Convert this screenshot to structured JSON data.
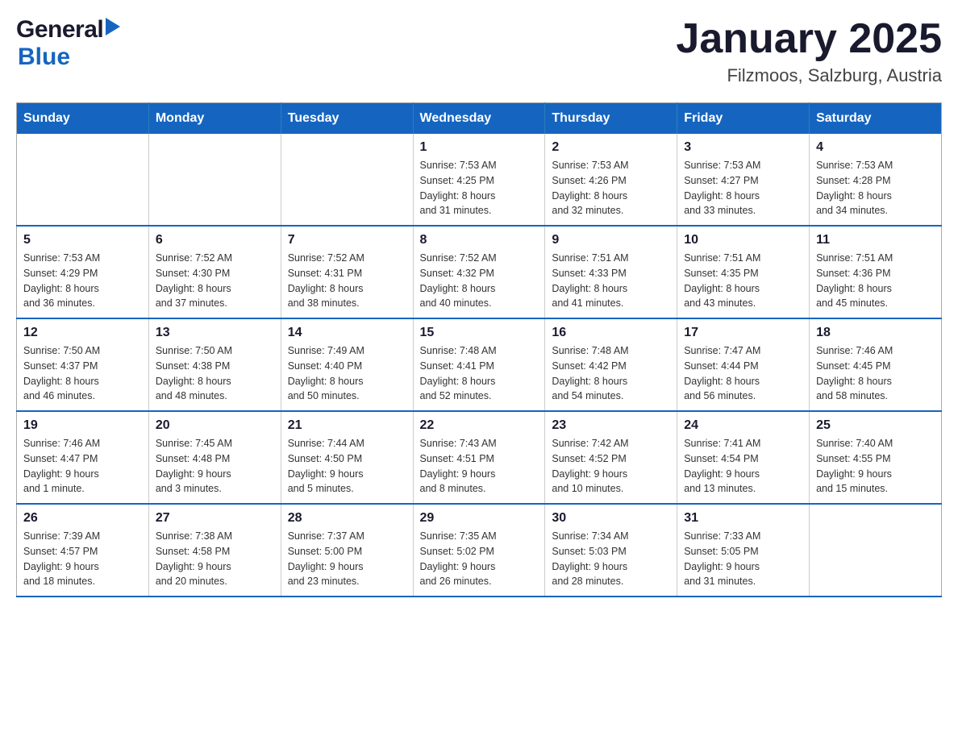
{
  "header": {
    "logo_general": "General",
    "logo_blue": "Blue",
    "title": "January 2025",
    "subtitle": "Filzmoos, Salzburg, Austria"
  },
  "days_of_week": [
    "Sunday",
    "Monday",
    "Tuesday",
    "Wednesday",
    "Thursday",
    "Friday",
    "Saturday"
  ],
  "weeks": [
    [
      {
        "day": "",
        "info": ""
      },
      {
        "day": "",
        "info": ""
      },
      {
        "day": "",
        "info": ""
      },
      {
        "day": "1",
        "info": "Sunrise: 7:53 AM\nSunset: 4:25 PM\nDaylight: 8 hours\nand 31 minutes."
      },
      {
        "day": "2",
        "info": "Sunrise: 7:53 AM\nSunset: 4:26 PM\nDaylight: 8 hours\nand 32 minutes."
      },
      {
        "day": "3",
        "info": "Sunrise: 7:53 AM\nSunset: 4:27 PM\nDaylight: 8 hours\nand 33 minutes."
      },
      {
        "day": "4",
        "info": "Sunrise: 7:53 AM\nSunset: 4:28 PM\nDaylight: 8 hours\nand 34 minutes."
      }
    ],
    [
      {
        "day": "5",
        "info": "Sunrise: 7:53 AM\nSunset: 4:29 PM\nDaylight: 8 hours\nand 36 minutes."
      },
      {
        "day": "6",
        "info": "Sunrise: 7:52 AM\nSunset: 4:30 PM\nDaylight: 8 hours\nand 37 minutes."
      },
      {
        "day": "7",
        "info": "Sunrise: 7:52 AM\nSunset: 4:31 PM\nDaylight: 8 hours\nand 38 minutes."
      },
      {
        "day": "8",
        "info": "Sunrise: 7:52 AM\nSunset: 4:32 PM\nDaylight: 8 hours\nand 40 minutes."
      },
      {
        "day": "9",
        "info": "Sunrise: 7:51 AM\nSunset: 4:33 PM\nDaylight: 8 hours\nand 41 minutes."
      },
      {
        "day": "10",
        "info": "Sunrise: 7:51 AM\nSunset: 4:35 PM\nDaylight: 8 hours\nand 43 minutes."
      },
      {
        "day": "11",
        "info": "Sunrise: 7:51 AM\nSunset: 4:36 PM\nDaylight: 8 hours\nand 45 minutes."
      }
    ],
    [
      {
        "day": "12",
        "info": "Sunrise: 7:50 AM\nSunset: 4:37 PM\nDaylight: 8 hours\nand 46 minutes."
      },
      {
        "day": "13",
        "info": "Sunrise: 7:50 AM\nSunset: 4:38 PM\nDaylight: 8 hours\nand 48 minutes."
      },
      {
        "day": "14",
        "info": "Sunrise: 7:49 AM\nSunset: 4:40 PM\nDaylight: 8 hours\nand 50 minutes."
      },
      {
        "day": "15",
        "info": "Sunrise: 7:48 AM\nSunset: 4:41 PM\nDaylight: 8 hours\nand 52 minutes."
      },
      {
        "day": "16",
        "info": "Sunrise: 7:48 AM\nSunset: 4:42 PM\nDaylight: 8 hours\nand 54 minutes."
      },
      {
        "day": "17",
        "info": "Sunrise: 7:47 AM\nSunset: 4:44 PM\nDaylight: 8 hours\nand 56 minutes."
      },
      {
        "day": "18",
        "info": "Sunrise: 7:46 AM\nSunset: 4:45 PM\nDaylight: 8 hours\nand 58 minutes."
      }
    ],
    [
      {
        "day": "19",
        "info": "Sunrise: 7:46 AM\nSunset: 4:47 PM\nDaylight: 9 hours\nand 1 minute."
      },
      {
        "day": "20",
        "info": "Sunrise: 7:45 AM\nSunset: 4:48 PM\nDaylight: 9 hours\nand 3 minutes."
      },
      {
        "day": "21",
        "info": "Sunrise: 7:44 AM\nSunset: 4:50 PM\nDaylight: 9 hours\nand 5 minutes."
      },
      {
        "day": "22",
        "info": "Sunrise: 7:43 AM\nSunset: 4:51 PM\nDaylight: 9 hours\nand 8 minutes."
      },
      {
        "day": "23",
        "info": "Sunrise: 7:42 AM\nSunset: 4:52 PM\nDaylight: 9 hours\nand 10 minutes."
      },
      {
        "day": "24",
        "info": "Sunrise: 7:41 AM\nSunset: 4:54 PM\nDaylight: 9 hours\nand 13 minutes."
      },
      {
        "day": "25",
        "info": "Sunrise: 7:40 AM\nSunset: 4:55 PM\nDaylight: 9 hours\nand 15 minutes."
      }
    ],
    [
      {
        "day": "26",
        "info": "Sunrise: 7:39 AM\nSunset: 4:57 PM\nDaylight: 9 hours\nand 18 minutes."
      },
      {
        "day": "27",
        "info": "Sunrise: 7:38 AM\nSunset: 4:58 PM\nDaylight: 9 hours\nand 20 minutes."
      },
      {
        "day": "28",
        "info": "Sunrise: 7:37 AM\nSunset: 5:00 PM\nDaylight: 9 hours\nand 23 minutes."
      },
      {
        "day": "29",
        "info": "Sunrise: 7:35 AM\nSunset: 5:02 PM\nDaylight: 9 hours\nand 26 minutes."
      },
      {
        "day": "30",
        "info": "Sunrise: 7:34 AM\nSunset: 5:03 PM\nDaylight: 9 hours\nand 28 minutes."
      },
      {
        "day": "31",
        "info": "Sunrise: 7:33 AM\nSunset: 5:05 PM\nDaylight: 9 hours\nand 31 minutes."
      },
      {
        "day": "",
        "info": ""
      }
    ]
  ]
}
